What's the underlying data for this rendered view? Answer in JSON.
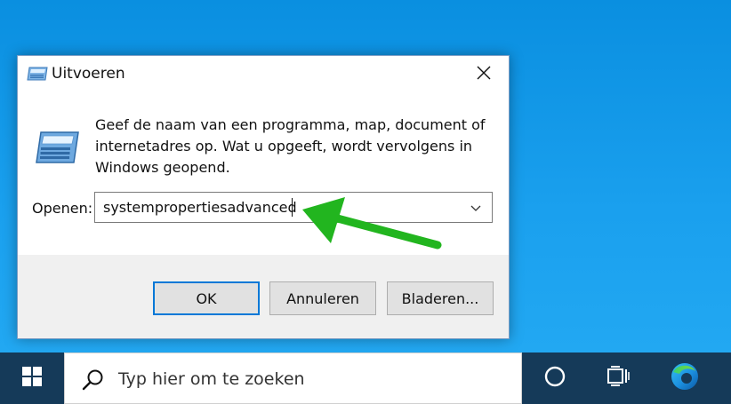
{
  "dialog": {
    "title": "Uitvoeren",
    "description": "Geef de naam van een programma, map, document of internetadres op. Wat u opgeeft, wordt vervolgens in Windows geopend.",
    "open_label": "Openen:",
    "input_value": "systempropertiesadvanced",
    "buttons": {
      "ok": "OK",
      "cancel": "Annuleren",
      "browse": "Bladeren..."
    },
    "icons": {
      "title": "run-icon",
      "main": "run-icon",
      "close": "close-icon",
      "dropdown": "chevron-down-icon"
    }
  },
  "annotation": {
    "arrow_color": "#22b51f",
    "icon": "green-arrow-icon"
  },
  "taskbar": {
    "search_placeholder": "Typ hier om te zoeken",
    "background_color": "#153a59",
    "icons": [
      "windows-start-icon",
      "search-icon",
      "cortana-icon",
      "task-view-icon",
      "edge-icon"
    ]
  },
  "colors": {
    "desktop": "#1a9be8",
    "accent": "#0078d7"
  }
}
